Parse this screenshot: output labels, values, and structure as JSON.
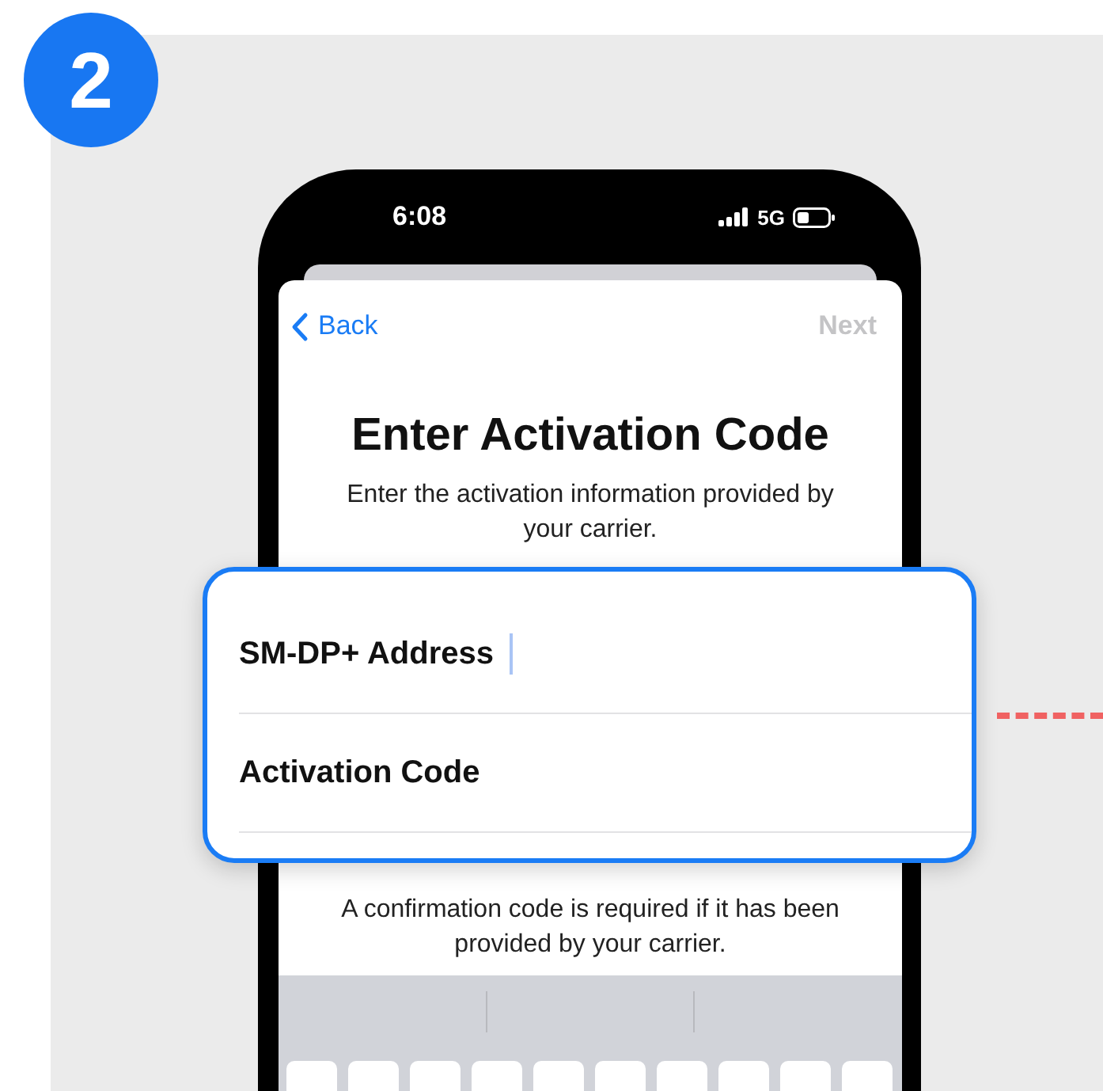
{
  "step_badge": "2",
  "status_bar": {
    "time": "6:08",
    "network": "5G"
  },
  "nav": {
    "back": "Back",
    "next": "Next",
    "next_disabled": true
  },
  "title": "Enter Activation Code",
  "subtitle": "Enter the activation information provided by your carrier.",
  "fields": [
    {
      "kind": "cursor",
      "label": "SM-DP+ Address"
    },
    {
      "kind": "plain",
      "label": "Activation Code"
    }
  ],
  "footnote": "A confirmation code is required if it has been provided by your carrier."
}
